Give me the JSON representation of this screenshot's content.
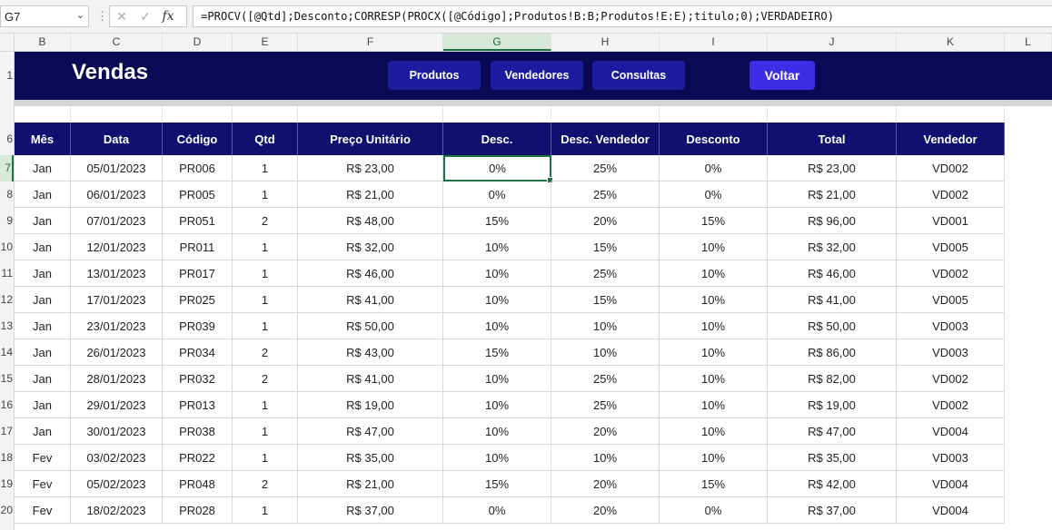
{
  "formula_bar": {
    "name_box": "G7",
    "cancel_glyph": "✕",
    "enter_glyph": "✓",
    "fx_label": "fx",
    "formula": "=PROCV([@Qtd];Desconto;CORRESP(PROCX([@Código];Produtos!B:B;Produtos!E:E);titulo;0);VERDADEIRO)"
  },
  "columns": [
    "B",
    "C",
    "D",
    "E",
    "F",
    "G",
    "H",
    "I",
    "J",
    "K",
    "L"
  ],
  "selected_column": "G",
  "row_numbers": [
    "1",
    "6",
    "7",
    "8",
    "9",
    "10",
    "11",
    "12",
    "13",
    "14",
    "15",
    "16",
    "17",
    "18",
    "19",
    "20"
  ],
  "selected_row": "7",
  "banner": {
    "title": "Vendas",
    "buttons": [
      "Produtos",
      "Vendedores",
      "Consultas"
    ],
    "back_button": "Voltar"
  },
  "colors": {
    "banner_bg": "#0a0a54",
    "header_bg": "#101070",
    "button_bg": "#1c1ca0",
    "accent": "#3d2de6",
    "selection": "#217346"
  },
  "table": {
    "headers": [
      "Mês",
      "Data",
      "Código",
      "Qtd",
      "Preço Unitário",
      "Desc.",
      "Desc. Vendedor",
      "Desconto",
      "Total",
      "Vendedor"
    ],
    "rows": [
      [
        "Jan",
        "05/01/2023",
        "PR006",
        "1",
        "R$ 23,00",
        "0%",
        "25%",
        "0%",
        "R$ 23,00",
        "VD002"
      ],
      [
        "Jan",
        "06/01/2023",
        "PR005",
        "1",
        "R$ 21,00",
        "0%",
        "25%",
        "0%",
        "R$ 21,00",
        "VD002"
      ],
      [
        "Jan",
        "07/01/2023",
        "PR051",
        "2",
        "R$ 48,00",
        "15%",
        "20%",
        "15%",
        "R$ 96,00",
        "VD001"
      ],
      [
        "Jan",
        "12/01/2023",
        "PR011",
        "1",
        "R$ 32,00",
        "10%",
        "15%",
        "10%",
        "R$ 32,00",
        "VD005"
      ],
      [
        "Jan",
        "13/01/2023",
        "PR017",
        "1",
        "R$ 46,00",
        "10%",
        "25%",
        "10%",
        "R$ 46,00",
        "VD002"
      ],
      [
        "Jan",
        "17/01/2023",
        "PR025",
        "1",
        "R$ 41,00",
        "10%",
        "15%",
        "10%",
        "R$ 41,00",
        "VD005"
      ],
      [
        "Jan",
        "23/01/2023",
        "PR039",
        "1",
        "R$ 50,00",
        "10%",
        "10%",
        "10%",
        "R$ 50,00",
        "VD003"
      ],
      [
        "Jan",
        "26/01/2023",
        "PR034",
        "2",
        "R$ 43,00",
        "15%",
        "10%",
        "10%",
        "R$ 86,00",
        "VD003"
      ],
      [
        "Jan",
        "28/01/2023",
        "PR032",
        "2",
        "R$ 41,00",
        "10%",
        "25%",
        "10%",
        "R$ 82,00",
        "VD002"
      ],
      [
        "Jan",
        "29/01/2023",
        "PR013",
        "1",
        "R$ 19,00",
        "10%",
        "25%",
        "10%",
        "R$ 19,00",
        "VD002"
      ],
      [
        "Jan",
        "30/01/2023",
        "PR038",
        "1",
        "R$ 47,00",
        "10%",
        "20%",
        "10%",
        "R$ 47,00",
        "VD004"
      ],
      [
        "Fev",
        "03/02/2023",
        "PR022",
        "1",
        "R$ 35,00",
        "10%",
        "10%",
        "10%",
        "R$ 35,00",
        "VD003"
      ],
      [
        "Fev",
        "05/02/2023",
        "PR048",
        "2",
        "R$ 21,00",
        "15%",
        "20%",
        "15%",
        "R$ 42,00",
        "VD004"
      ],
      [
        "Fev",
        "18/02/2023",
        "PR028",
        "1",
        "R$ 37,00",
        "0%",
        "20%",
        "0%",
        "R$ 37,00",
        "VD004"
      ]
    ]
  }
}
